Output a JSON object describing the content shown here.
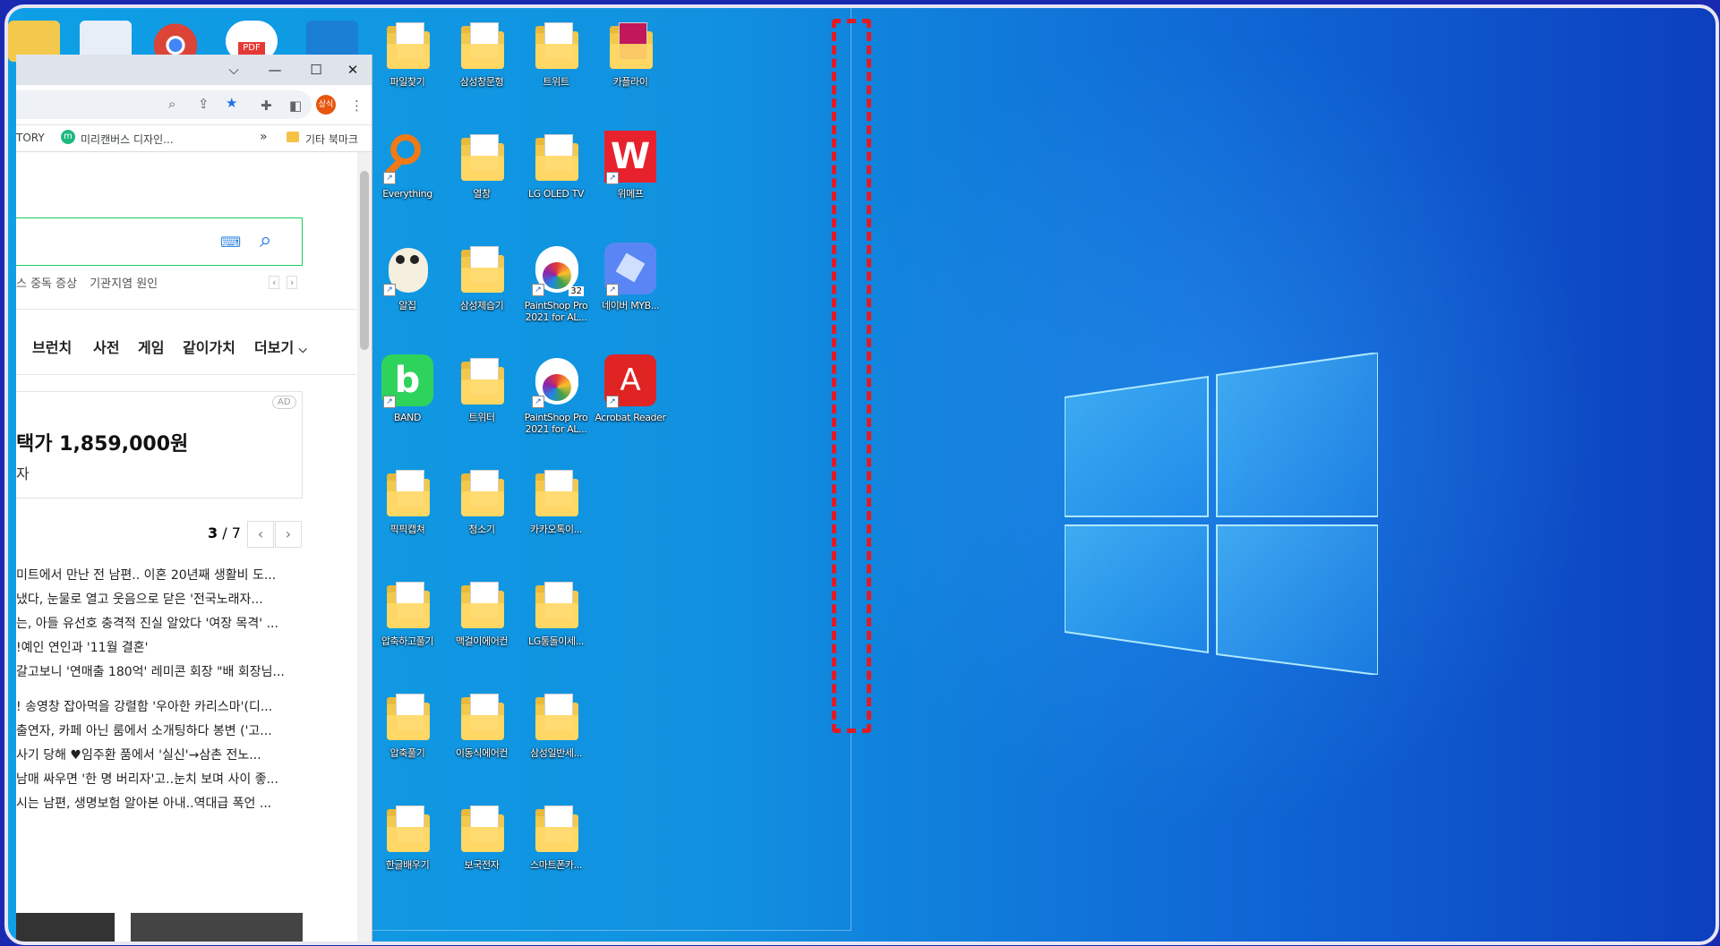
{
  "desktop": {
    "icons": [
      {
        "label": "파일찾기",
        "kind": "folder"
      },
      {
        "label": "삼성창문형",
        "kind": "folder"
      },
      {
        "label": "트위트",
        "kind": "folder"
      },
      {
        "label": "카플라이",
        "kind": "folder-pink"
      },
      {
        "label": "Everything",
        "kind": "magnifier"
      },
      {
        "label": "열창",
        "kind": "folder"
      },
      {
        "label": "LG OLED TV",
        "kind": "folder"
      },
      {
        "label": "위메프",
        "kind": "wemakeprice"
      },
      {
        "label": "알집",
        "kind": "alzip"
      },
      {
        "label": "삼성제습기",
        "kind": "folder"
      },
      {
        "label": "PaintShop Pro 2021 for AL...",
        "kind": "paintshop",
        "badge": "32"
      },
      {
        "label": "네이버 MYB...",
        "kind": "naver-myb"
      },
      {
        "label": "BAND",
        "kind": "band"
      },
      {
        "label": "트위터",
        "kind": "folder"
      },
      {
        "label": "PaintShop Pro 2021 for AL...",
        "kind": "paintshop"
      },
      {
        "label": "Acrobat Reader",
        "kind": "acrobat"
      },
      {
        "label": "픽픽캡쳐",
        "kind": "folder"
      },
      {
        "label": "청소기",
        "kind": "folder"
      },
      {
        "label": "카카오톡이...",
        "kind": "folder"
      },
      {
        "label": "압축하고풀기",
        "kind": "folder"
      },
      {
        "label": "맥걸이에어컨",
        "kind": "folder"
      },
      {
        "label": "LG통돌이세...",
        "kind": "folder"
      },
      {
        "label": "압축풀기",
        "kind": "folder"
      },
      {
        "label": "이동식에어컨",
        "kind": "folder"
      },
      {
        "label": "삼성일반세...",
        "kind": "folder"
      },
      {
        "label": "한글배우기",
        "kind": "folder"
      },
      {
        "label": "보국전자",
        "kind": "folder"
      },
      {
        "label": "스마트폰카...",
        "kind": "folder"
      }
    ]
  },
  "browser": {
    "profile_badge": "상식",
    "bookmarks": {
      "item1": "TORY",
      "item2": "미리캔버스 디자인...",
      "more": "»",
      "other": "기타 북마크"
    },
    "trending": {
      "k1": "스 중독 증상",
      "k2": "기관지염 원인"
    },
    "nav_tabs": [
      "브런치",
      "사전",
      "게임",
      "같이가치",
      "더보기"
    ],
    "ad": {
      "badge": "AD",
      "price": "택가 1,859,000원",
      "sub": "자"
    },
    "pager": {
      "current": "3",
      "total": "/ 7"
    },
    "news": [
      "미트에서 만난 전 남편.. 이혼 20년째 생활비 도...",
      "냈다, 눈물로 열고 웃음으로 닫은 '전국노래자...",
      "는, 아들 유선호 충격적 진실 알았다 '여장 목격' ...",
      "!예인 연인과 '11월 결혼'",
      "갈고보니 '연매출 180억' 레미콘 회장 \"배 회장님...",
      "! 송영창 잡아먹을 강렬함 '우아한 카리스마'(디...",
      "출연자, 카페 아닌 룸에서 소개팅하다 봉변 ('고...",
      "사기 당해 ♥임주환 품에서 '실신'→삼촌 전노...",
      "남매 싸우면 '한 명 버리자'고..눈치 보며 사이 좋...",
      "시는 남편, 생명보험 알아본 아내..역대급 폭언 ..."
    ]
  }
}
